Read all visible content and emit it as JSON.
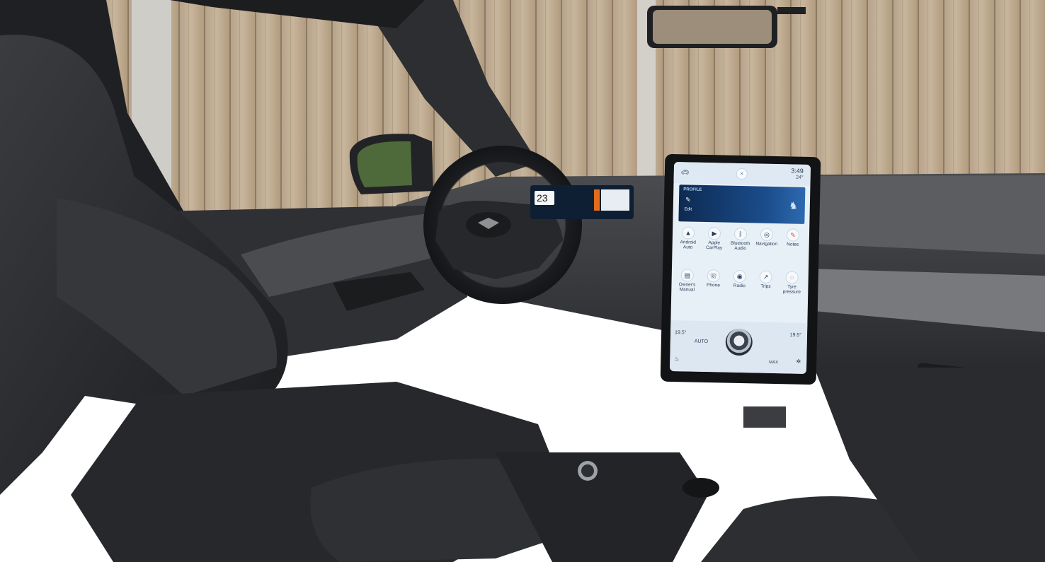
{
  "scene": {
    "description_free": true
  },
  "screen": {
    "time": "3:49",
    "temp_outside": "24°",
    "profile_label": "PROFILE",
    "edit_label": "Edit",
    "apps": [
      {
        "label": "Android Auto",
        "icon": "android-auto-icon",
        "glyph": "▲"
      },
      {
        "label": "Apple CarPlay",
        "icon": "carplay-icon",
        "glyph": "▶"
      },
      {
        "label": "Bluetooth Audio",
        "icon": "bluetooth-icon",
        "glyph": "ᛒ"
      },
      {
        "label": "Navigation",
        "icon": "navigation-icon",
        "glyph": "◎"
      },
      {
        "label": "Notes",
        "icon": "notes-icon",
        "glyph": "✎"
      },
      {
        "label": "Owner's Manual",
        "icon": "manual-icon",
        "glyph": "▤"
      },
      {
        "label": "Phone",
        "icon": "phone-icon",
        "glyph": "☏"
      },
      {
        "label": "Radio",
        "icon": "radio-icon",
        "glyph": "◉"
      },
      {
        "label": "Trips",
        "icon": "trips-icon",
        "glyph": "↗"
      },
      {
        "label": "Tyre pressure",
        "icon": "tyre-pressure-icon",
        "glyph": "◌"
      }
    ],
    "climate": {
      "left_temp": "19.5°",
      "mode": "AUTO",
      "right_temp": "19.5°",
      "fan_label": "MAX"
    }
  },
  "cluster": {
    "speed": "23"
  },
  "colors": {
    "fence": "#b8a48a",
    "screen_bg": "#e8f0f7",
    "banner": "#1b4d8c",
    "interior": "#2b2d30"
  }
}
